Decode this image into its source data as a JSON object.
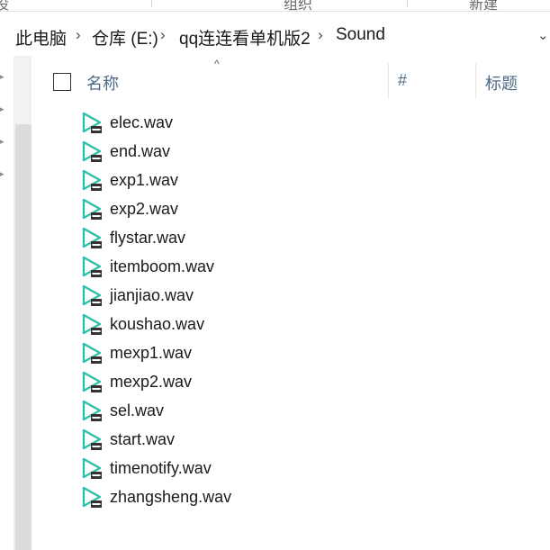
{
  "ribbon": {
    "frag_left": "设",
    "frag_mid": "组织",
    "frag_right": "新建"
  },
  "breadcrumb": {
    "items": [
      "此电脑",
      "仓库 (E:)",
      "qq连连看单机版2",
      "Sound"
    ]
  },
  "columns": {
    "name": "名称",
    "number": "#",
    "title": "标题"
  },
  "files": [
    "elec.wav",
    "end.wav",
    "exp1.wav",
    "exp2.wav",
    "flystar.wav",
    "itemboom.wav",
    "jianjiao.wav",
    "koushao.wav",
    "mexp1.wav",
    "mexp2.wav",
    "sel.wav",
    "start.wav",
    "timenotify.wav",
    "zhangsheng.wav"
  ],
  "colors": {
    "icon_teal": "#2bc0a8",
    "icon_dark": "#333333",
    "header_text": "#4d6a87"
  },
  "icons": {
    "file": "audio-play-file-icon"
  }
}
